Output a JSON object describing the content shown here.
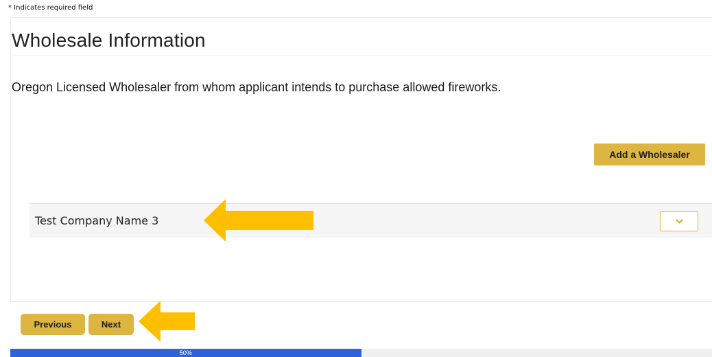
{
  "required_note": "* Indicates required field",
  "section": {
    "title": "Wholesale Information",
    "description": "Oregon Licensed Wholesaler from whom applicant intends to purchase allowed fireworks."
  },
  "add_button_label": "Add a Wholesaler",
  "wholesalers": [
    {
      "name": "Test Company Name 3",
      "toggle_icon": "chevron-down-icon"
    }
  ],
  "nav": {
    "previous_label": "Previous",
    "next_label": "Next"
  },
  "progress": {
    "percent": 50,
    "label": "50%"
  },
  "colors": {
    "accent_gold": "#dcb640",
    "annotation_arrow": "#fdbf00",
    "progress_blue": "#2f63dc"
  }
}
